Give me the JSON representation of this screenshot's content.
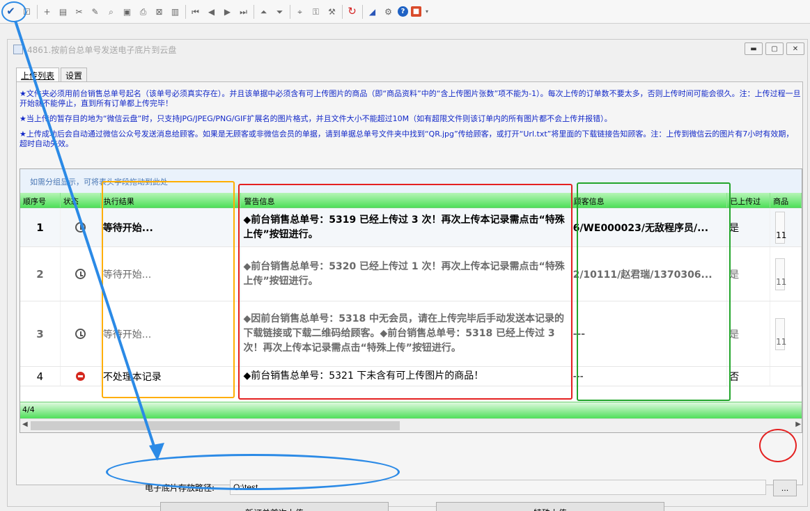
{
  "toolbar": {
    "buttons": [
      {
        "name": "check",
        "glyph": "✔"
      },
      {
        "name": "checkbox",
        "glyph": "☑"
      },
      {
        "name": "add",
        "glyph": "+"
      },
      {
        "name": "insert-row",
        "glyph": "▤"
      },
      {
        "name": "tools",
        "glyph": "✂"
      },
      {
        "name": "edit",
        "glyph": "✎"
      },
      {
        "name": "find",
        "glyph": "⌕"
      },
      {
        "name": "print-preview",
        "glyph": "▣"
      },
      {
        "name": "print",
        "glyph": "⎙"
      },
      {
        "name": "export",
        "glyph": "⊠"
      },
      {
        "name": "library",
        "glyph": "▥"
      },
      {
        "name": "first",
        "glyph": "⏮"
      },
      {
        "name": "prev",
        "glyph": "◀"
      },
      {
        "name": "next",
        "glyph": "▶"
      },
      {
        "name": "last",
        "glyph": "⏭"
      },
      {
        "name": "move-up",
        "glyph": "⏶"
      },
      {
        "name": "move-down",
        "glyph": "⏷"
      },
      {
        "name": "zoom",
        "glyph": "⌖"
      },
      {
        "name": "key",
        "glyph": "⚿"
      },
      {
        "name": "key-edit",
        "glyph": "⚒"
      },
      {
        "name": "refresh",
        "glyph": "↻"
      },
      {
        "name": "chart",
        "glyph": "◢"
      },
      {
        "name": "settings",
        "glyph": "⚙"
      },
      {
        "name": "help",
        "glyph": "?"
      },
      {
        "name": "stop",
        "glyph": "■"
      }
    ]
  },
  "window": {
    "title": "4861.按前台总单号发送电子底片到云盘",
    "controls": {
      "minimize": "▬",
      "restore": "▢",
      "close": "✕"
    }
  },
  "tabs": [
    {
      "label": "上传列表",
      "active": true
    },
    {
      "label": "设置",
      "active": false
    }
  ],
  "notes": [
    "★文件夹必须用前台销售总单号起名（该单号必须真实存在）。并且该单据中必须含有可上传图片的商品（即“商品资料”中的“含上传图片张数”项不能为-1）。每次上传的订单数不要太多，否则上传时间可能会很久。注：上传过程一旦开始就不能停止，直到所有订单都上传完毕！",
    "★当上传的暂存目的地为“微信云盘”时，只支持JPG/JPEG/PNG/GIF扩展名的图片格式，并且文件大小不能超过10M（如有超限文件则该订单内的所有图片都不会上传并报错）。",
    "★上传成功后会自动通过微信公众号发送消息给顾客。如果是无顾客或非微信会员的单据，请到单据总单号文件夹中找到“QR.jpg”传给顾客，或打开“Url.txt”将里面的下载链接告知顾客。注：上传到微信云的图片有7小时有效期，超时自动失效。"
  ],
  "grid": {
    "group_hint": "如需分组显示，可将表头字段拖动到此处",
    "columns": [
      "顺序号",
      "状态",
      "执行结果",
      "警告信息",
      "顾客信息",
      "已上传过",
      "商品"
    ],
    "rows": [
      {
        "seq": "1",
        "status": "clock",
        "result": "等待开始...",
        "warning": "◆前台销售总单号：5319 已经上传过 3 次！再次上传本记录需点击“特殊上传”按钮进行。",
        "customer": "6/WE000023/无敌程序员/...",
        "uploaded": "是",
        "more": "11"
      },
      {
        "seq": "2",
        "status": "clock",
        "result": "等待开始...",
        "warning": "◆前台销售总单号：5320 已经上传过 1 次！再次上传本记录需点击“特殊上传”按钮进行。",
        "customer": "2/10111/赵君瑞/1370306...",
        "uploaded": "是",
        "more": "11"
      },
      {
        "seq": "3",
        "status": "clock",
        "result": "等待开始...",
        "warning": "◆因前台销售总单号：5318 中无会员，请在上传完毕后手动发送本记录的下载链接或下载二维码给顾客。◆前台销售总单号：5318 已经上传过 3 次！再次上传本记录需点击“特殊上传”按钮进行。",
        "customer": "---",
        "uploaded": "是",
        "more": "11"
      },
      {
        "seq": "4",
        "status": "stop",
        "result": "不处理本记录",
        "warning": "◆前台销售总单号：5321 下未含有可上传图片的商品！",
        "customer": "---",
        "uploaded": "否",
        "more": ""
      }
    ],
    "footer_count": "4/4"
  },
  "path": {
    "label": "电子底片存放路径:",
    "value": "O:\\test",
    "browse_label": "..."
  },
  "buttons": {
    "new_upload": "新订单首次上传",
    "special_upload": "特殊上传"
  }
}
